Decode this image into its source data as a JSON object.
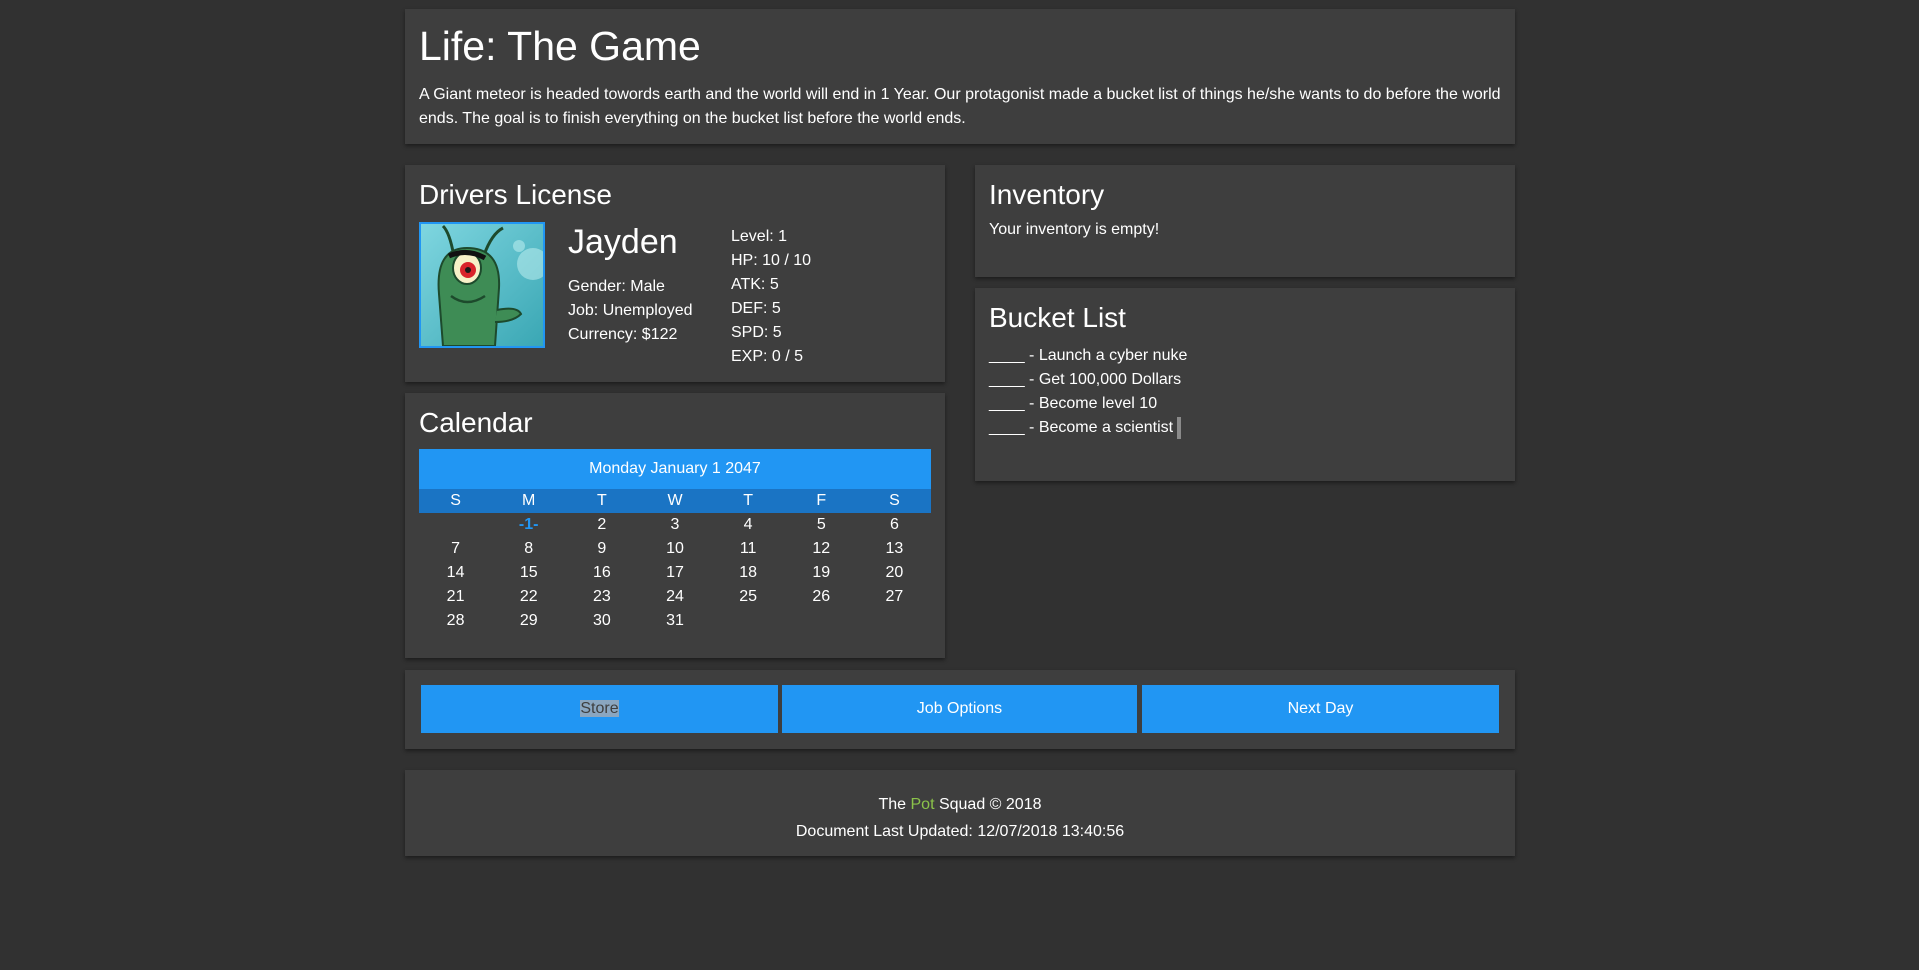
{
  "header": {
    "title": "Life: The Game",
    "description": "A Giant meteor is headed towords earth and the world will end in 1 Year. Our protagonist made a bucket list of things he/she wants to do before the world ends. The goal is to finish everything on the bucket list before the world ends."
  },
  "license": {
    "title": "Drivers License",
    "name": "Jayden",
    "gender": "Gender: Male",
    "job": "Job: Unemployed",
    "currency": "Currency: $122",
    "stats": [
      "Level: 1",
      "HP: 10 / 10",
      "ATK: 5",
      "DEF: 5",
      "SPD: 5",
      "EXP: 0 / 5"
    ]
  },
  "inventory": {
    "title": "Inventory",
    "empty_text": "Your inventory is empty!"
  },
  "bucket": {
    "title": "Bucket List",
    "items": [
      "____ - Launch a cyber nuke",
      "____ - Get 100,000 Dollars",
      "____ - Become level 10",
      "____ - Become a scientist"
    ]
  },
  "calendar": {
    "title": "Calendar",
    "date_header": "Monday January 1 2047",
    "weekdays": [
      "S",
      "M",
      "T",
      "W",
      "T",
      "F",
      "S"
    ],
    "days": [
      "",
      "-1-",
      "2",
      "3",
      "4",
      "5",
      "6",
      "7",
      "8",
      "9",
      "10",
      "11",
      "12",
      "13",
      "14",
      "15",
      "16",
      "17",
      "18",
      "19",
      "20",
      "21",
      "22",
      "23",
      "24",
      "25",
      "26",
      "27",
      "28",
      "29",
      "30",
      "31"
    ],
    "today": "-1-"
  },
  "actions": {
    "store": "Store",
    "job_options": "Job Options",
    "next_day": "Next Day"
  },
  "footer": {
    "line1_prefix": "The ",
    "line1_brand": "Pot",
    "line1_suffix": " Squad © 2018",
    "line2": "Document Last Updated: 12/07/2018 13:40:56"
  },
  "colors": {
    "background": "#313131",
    "card": "#3e3e3e",
    "accent": "#2196f3",
    "brand": "#8bc34a"
  }
}
